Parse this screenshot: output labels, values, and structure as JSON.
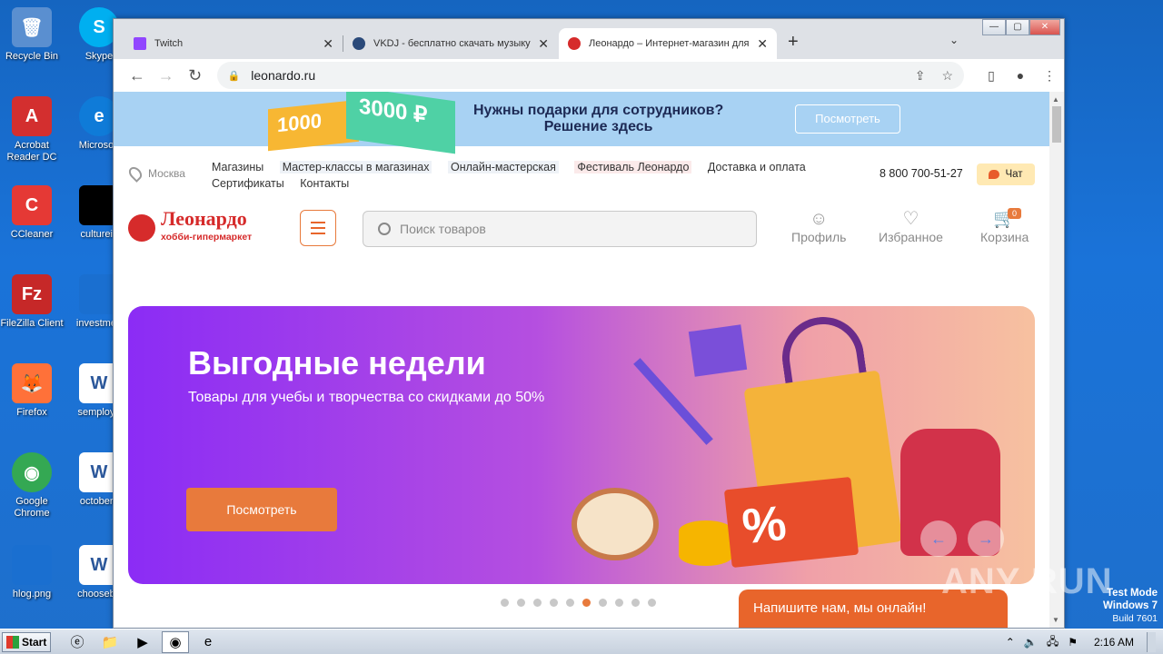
{
  "desktop": {
    "icons": [
      {
        "label": "Recycle Bin",
        "glyph": "🗑",
        "color": "#5a8fd0"
      },
      {
        "label": "Acrobat Reader DC",
        "glyph": "A",
        "color": "#d32f2f"
      },
      {
        "label": "CCleaner",
        "glyph": "C",
        "color": "#e53935"
      },
      {
        "label": "FileZilla Client",
        "glyph": "Fz",
        "color": "#c62828"
      },
      {
        "label": "Firefox",
        "glyph": "🦊",
        "color": "#ff7139"
      },
      {
        "label": "Google Chrome",
        "glyph": "◉",
        "color": "#34a853"
      },
      {
        "label": "hlog.png",
        "glyph": "",
        "color": "#1a6fd0"
      },
      {
        "label": "Skype",
        "glyph": "S",
        "color": "#00aff0"
      },
      {
        "label": "Microsoft",
        "glyph": "e",
        "color": "#0f7bd8"
      },
      {
        "label": "cultureis",
        "glyph": "",
        "color": "#000000"
      },
      {
        "label": "investmen",
        "glyph": "",
        "color": "#1a6fd0"
      },
      {
        "label": "semploye",
        "glyph": "W",
        "color": "#2b579a"
      },
      {
        "label": "octoberc",
        "glyph": "W",
        "color": "#2b579a"
      },
      {
        "label": "chooseba",
        "glyph": "W",
        "color": "#2b579a"
      }
    ]
  },
  "browser": {
    "tabs": [
      {
        "title": "Twitch",
        "fav_color": "#9146ff"
      },
      {
        "title": "VKDJ - бесплатно скачать музыку",
        "fav_color": "#2b4a7a"
      },
      {
        "title": "Леонардо – Интернет-магазин для",
        "fav_color": "#d62b2b"
      }
    ],
    "new_tab": "+",
    "tab_dropdown": "⌄",
    "window_controls": {
      "minimize": "—",
      "maximize": "▢",
      "close": "✕"
    },
    "nav": {
      "back": "←",
      "forward": "→",
      "reload": "↻"
    },
    "url": "leonardo.ru",
    "lock": "🔒"
  },
  "page": {
    "promo": {
      "card1": "1000",
      "card2": "3000 ₽",
      "line1": "Нужны подарки для сотрудников?",
      "line2": "Решение здесь",
      "button": "Посмотреть"
    },
    "city": "Москва",
    "links_row1": [
      "Магазины",
      "Мастер-классы в магазинах",
      "Онлайн-мастерская",
      "Фестиваль Леонардо",
      "Доставка и оплата"
    ],
    "links_row2": [
      "Сертификаты",
      "Контакты"
    ],
    "phone": "8 800 700-51-27",
    "chat": "Чат",
    "logo": {
      "name": "Леонардо",
      "sub": "хобби-гипермаркет"
    },
    "search_placeholder": "Поиск товаров",
    "profile": "Профиль",
    "favorites": "Избранное",
    "cart": "Корзина",
    "cart_count": "0",
    "hero": {
      "title": "Выгодные недели",
      "subtitle": "Товары для учебы и творчества со скидками до 50%",
      "button": "Посмотреть",
      "percent": "%"
    },
    "carousel": {
      "total": 10,
      "active_index": 5
    },
    "livechat": "Напишите нам, мы онлайн!"
  },
  "overlay": {
    "watermark": "ANY RUN",
    "test_mode": "Test Mode",
    "os": "Windows 7",
    "build": "Build 7601"
  },
  "taskbar": {
    "start": "Start",
    "clock": "2:16 AM"
  }
}
